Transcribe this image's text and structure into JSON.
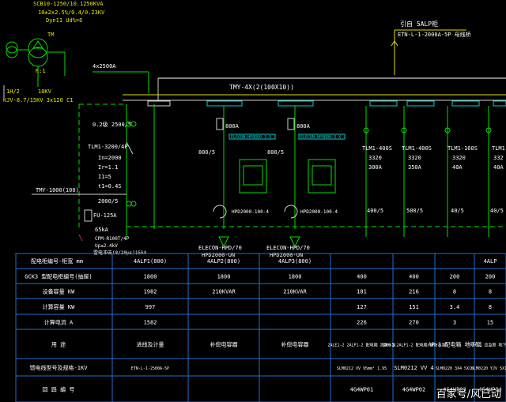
{
  "transformer": {
    "model": "SCB10-1250/10.1250KVA",
    "ratio": "10±2x2.5%/0.4/0.23KV",
    "vector": "Dyn11  Ud%=6",
    "tm": "TM",
    "label_r": "R:1",
    "left_code": "1H/2",
    "left_kv": "10KV",
    "cable": "KJV-8.7/15KV 3x120  C1"
  },
  "feed_note": {
    "title": "引自 5ALP柜",
    "spec": "ETN-L-1-2000A-5P 母线桥"
  },
  "bus_top": "4x2500A",
  "bus_label": "TMY-4X(2(100X10))",
  "incomer": {
    "ct": "0.2级 2500/5",
    "breaker": "TLM1-3200/4P",
    "settings": [
      "In=2000",
      "Ir=1.1",
      "I1=5",
      "t1=0.4S"
    ],
    "tmy": "TMY-1000(100)",
    "ct2": "2000/5",
    "fu": "FU-125A",
    "k": "65kA",
    "spd": [
      "CPM-R100T/4P",
      "Up≤2.4kV",
      "雷电冲击(8/20μs)15kA"
    ]
  },
  "caps": [
    {
      "fuse": "800A",
      "ratio": "800/5",
      "unit": "ELECON-HP0R00-3-X",
      "module": "HPD2000-100-4",
      "bottom1": "ELECON-HPD/70",
      "bottom2": "HPD2000-UN"
    },
    {
      "fuse": "800A",
      "ratio": "800/5",
      "unit": "ELECON-HP0R00-3-X",
      "module": "HPD2000-100-4",
      "bottom1": "ELECON-HPD/70",
      "bottom2": "HPD2000-UN"
    }
  ],
  "feeders": [
    {
      "breaker": "TLM1-400S",
      "n": "3320",
      "amp": "300A",
      "ct": "400/5"
    },
    {
      "breaker": "TLM1-400S",
      "n": "3320",
      "amp": "350A",
      "ct": "500/5"
    },
    {
      "breaker": "TLM1-160S",
      "n": "3320",
      "amp": "40A",
      "ct": "40/5"
    },
    {
      "breaker": "TLM1-1",
      "n": "332",
      "amp": "40A",
      "ct": "40/5"
    }
  ],
  "table": {
    "header": [
      "配电柜编号-柜宽 mm",
      "4ALP1(800)",
      "4ALP2(800)",
      "4ALP3(800)",
      "",
      "",
      "",
      "4ALP"
    ],
    "rows": [
      {
        "label": "GCK3 型配电柜编号(抽屉)",
        "cells": [
          "1800",
          "1800",
          "1800",
          "400",
          "400",
          "200",
          "200"
        ]
      },
      {
        "label": "设备容量 KW",
        "cells": [
          "1982",
          "210KVAR",
          "210KVAR",
          "181",
          "216",
          "8",
          "8"
        ]
      },
      {
        "label": "计算容量 KW",
        "cells": [
          "997",
          "",
          "",
          "127",
          "151",
          "3.4",
          "8"
        ]
      },
      {
        "label": "计算电流 A",
        "cells": [
          "1582",
          "",
          "",
          "226",
          "270",
          "3",
          "15"
        ]
      },
      {
        "label": "用 途",
        "cells": [
          "进线及计量",
          "补偿电容器",
          "补偿电容器",
          "2ALE1-2 2ALP1-2 配电箱 消防水泵",
          "1AM-1 2ALP1-2 配电箱 消防水泵",
          "AP-1 配电箱 地下室",
          "RAP-1 应急照 地下室"
        ]
      },
      {
        "label": "馈电线型号及规格-1KV",
        "cells": [
          "ETN-L-1-2500A-5P",
          "",
          "",
          "SLM0212 VV 95mm² 1.95",
          "SLM0212 VV 4",
          "SLM0220 3X4 5X10",
          "SLM0220 YJV 5X10"
        ]
      },
      {
        "label": "回 路 编 号",
        "cells": [
          "",
          "",
          "",
          "4G4WP01",
          "4G4WP02",
          "4G4WP03",
          "4G4WP04"
        ]
      }
    ]
  },
  "watermark": "百家号/风已动"
}
